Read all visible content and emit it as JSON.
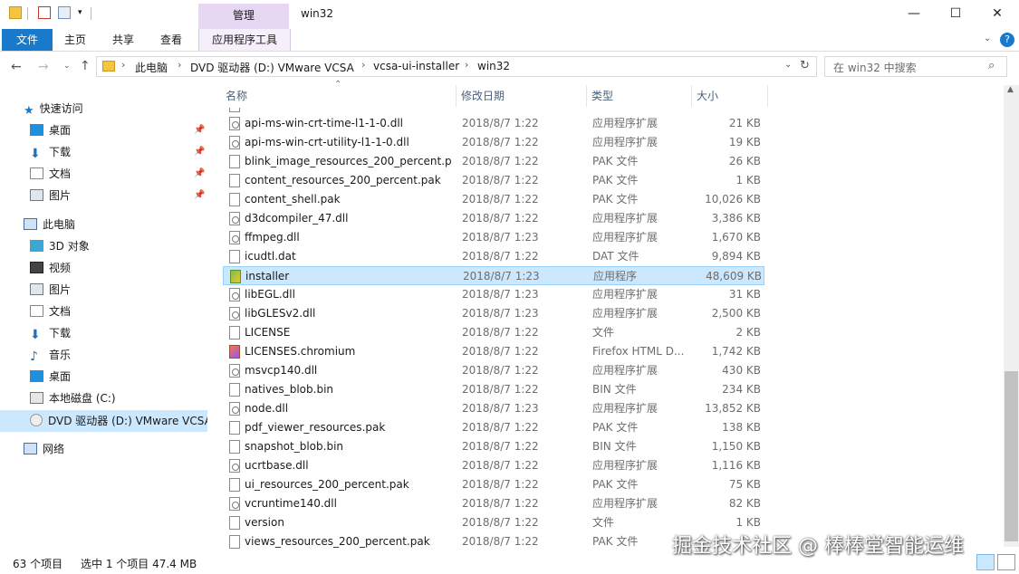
{
  "window": {
    "title": "win32",
    "context_tab_group": "管理",
    "controls": {
      "minimize": "—",
      "maximize": "☐",
      "close": "✕"
    }
  },
  "ribbon": {
    "tabs": [
      "文件",
      "主页",
      "共享",
      "查看",
      "应用程序工具"
    ],
    "collapse_icon": "chevron-down",
    "help_icon": "?"
  },
  "address": {
    "breadcrumbs": [
      "此电脑",
      "DVD 驱动器 (D:) VMware VCSA",
      "vcsa-ui-installer",
      "win32"
    ]
  },
  "search": {
    "placeholder": "在 win32 中搜索"
  },
  "nav": {
    "quick_access": "快速访问",
    "quick_items": [
      "桌面",
      "下载",
      "文档",
      "图片"
    ],
    "this_pc": "此电脑",
    "pc_items": [
      "3D 对象",
      "视频",
      "图片",
      "文档",
      "下载",
      "音乐",
      "桌面",
      "本地磁盘 (C:)",
      "DVD 驱动器 (D:) VMware VCSA"
    ],
    "network": "网络"
  },
  "columns": {
    "name": "名称",
    "date": "修改日期",
    "type": "类型",
    "size": "大小"
  },
  "files": [
    {
      "name": "api-ms-win-crt-time-l1-1-0.dll",
      "date": "2018/8/7 1:22",
      "type": "应用程序扩展",
      "size": "21 KB",
      "icon": "dll"
    },
    {
      "name": "api-ms-win-crt-utility-l1-1-0.dll",
      "date": "2018/8/7 1:22",
      "type": "应用程序扩展",
      "size": "19 KB",
      "icon": "dll"
    },
    {
      "name": "blink_image_resources_200_percent.p...",
      "date": "2018/8/7 1:22",
      "type": "PAK 文件",
      "size": "26 KB",
      "icon": "file"
    },
    {
      "name": "content_resources_200_percent.pak",
      "date": "2018/8/7 1:22",
      "type": "PAK 文件",
      "size": "1 KB",
      "icon": "file"
    },
    {
      "name": "content_shell.pak",
      "date": "2018/8/7 1:22",
      "type": "PAK 文件",
      "size": "10,026 KB",
      "icon": "file"
    },
    {
      "name": "d3dcompiler_47.dll",
      "date": "2018/8/7 1:22",
      "type": "应用程序扩展",
      "size": "3,386 KB",
      "icon": "dll"
    },
    {
      "name": "ffmpeg.dll",
      "date": "2018/8/7 1:23",
      "type": "应用程序扩展",
      "size": "1,670 KB",
      "icon": "dll"
    },
    {
      "name": "icudtl.dat",
      "date": "2018/8/7 1:22",
      "type": "DAT 文件",
      "size": "9,894 KB",
      "icon": "file"
    },
    {
      "name": "installer",
      "date": "2018/8/7 1:23",
      "type": "应用程序",
      "size": "48,609 KB",
      "icon": "exe",
      "selected": true
    },
    {
      "name": "libEGL.dll",
      "date": "2018/8/7 1:23",
      "type": "应用程序扩展",
      "size": "31 KB",
      "icon": "dll"
    },
    {
      "name": "libGLESv2.dll",
      "date": "2018/8/7 1:23",
      "type": "应用程序扩展",
      "size": "2,500 KB",
      "icon": "dll"
    },
    {
      "name": "LICENSE",
      "date": "2018/8/7 1:22",
      "type": "文件",
      "size": "2 KB",
      "icon": "file"
    },
    {
      "name": "LICENSES.chromium",
      "date": "2018/8/7 1:22",
      "type": "Firefox HTML D...",
      "size": "1,742 KB",
      "icon": "ff"
    },
    {
      "name": "msvcp140.dll",
      "date": "2018/8/7 1:22",
      "type": "应用程序扩展",
      "size": "430 KB",
      "icon": "dll"
    },
    {
      "name": "natives_blob.bin",
      "date": "2018/8/7 1:22",
      "type": "BIN 文件",
      "size": "234 KB",
      "icon": "file"
    },
    {
      "name": "node.dll",
      "date": "2018/8/7 1:23",
      "type": "应用程序扩展",
      "size": "13,852 KB",
      "icon": "dll"
    },
    {
      "name": "pdf_viewer_resources.pak",
      "date": "2018/8/7 1:22",
      "type": "PAK 文件",
      "size": "138 KB",
      "icon": "file"
    },
    {
      "name": "snapshot_blob.bin",
      "date": "2018/8/7 1:22",
      "type": "BIN 文件",
      "size": "1,150 KB",
      "icon": "file"
    },
    {
      "name": "ucrtbase.dll",
      "date": "2018/8/7 1:22",
      "type": "应用程序扩展",
      "size": "1,116 KB",
      "icon": "dll"
    },
    {
      "name": "ui_resources_200_percent.pak",
      "date": "2018/8/7 1:22",
      "type": "PAK 文件",
      "size": "75 KB",
      "icon": "file"
    },
    {
      "name": "vcruntime140.dll",
      "date": "2018/8/7 1:22",
      "type": "应用程序扩展",
      "size": "82 KB",
      "icon": "dll"
    },
    {
      "name": "version",
      "date": "2018/8/7 1:22",
      "type": "文件",
      "size": "1 KB",
      "icon": "file"
    },
    {
      "name": "views_resources_200_percent.pak",
      "date": "2018/8/7 1:22",
      "type": "PAK 文件",
      "size": "",
      "icon": "file"
    }
  ],
  "status": {
    "count": "63 个项目",
    "selection": "选中 1 个项目  47.4 MB"
  },
  "watermark": "掘金技术社区 @ 棒棒堂智能运维",
  "colors": {
    "accent": "#1979ca",
    "selection": "#cce8ff",
    "context_tab": "#e6d8f2"
  }
}
